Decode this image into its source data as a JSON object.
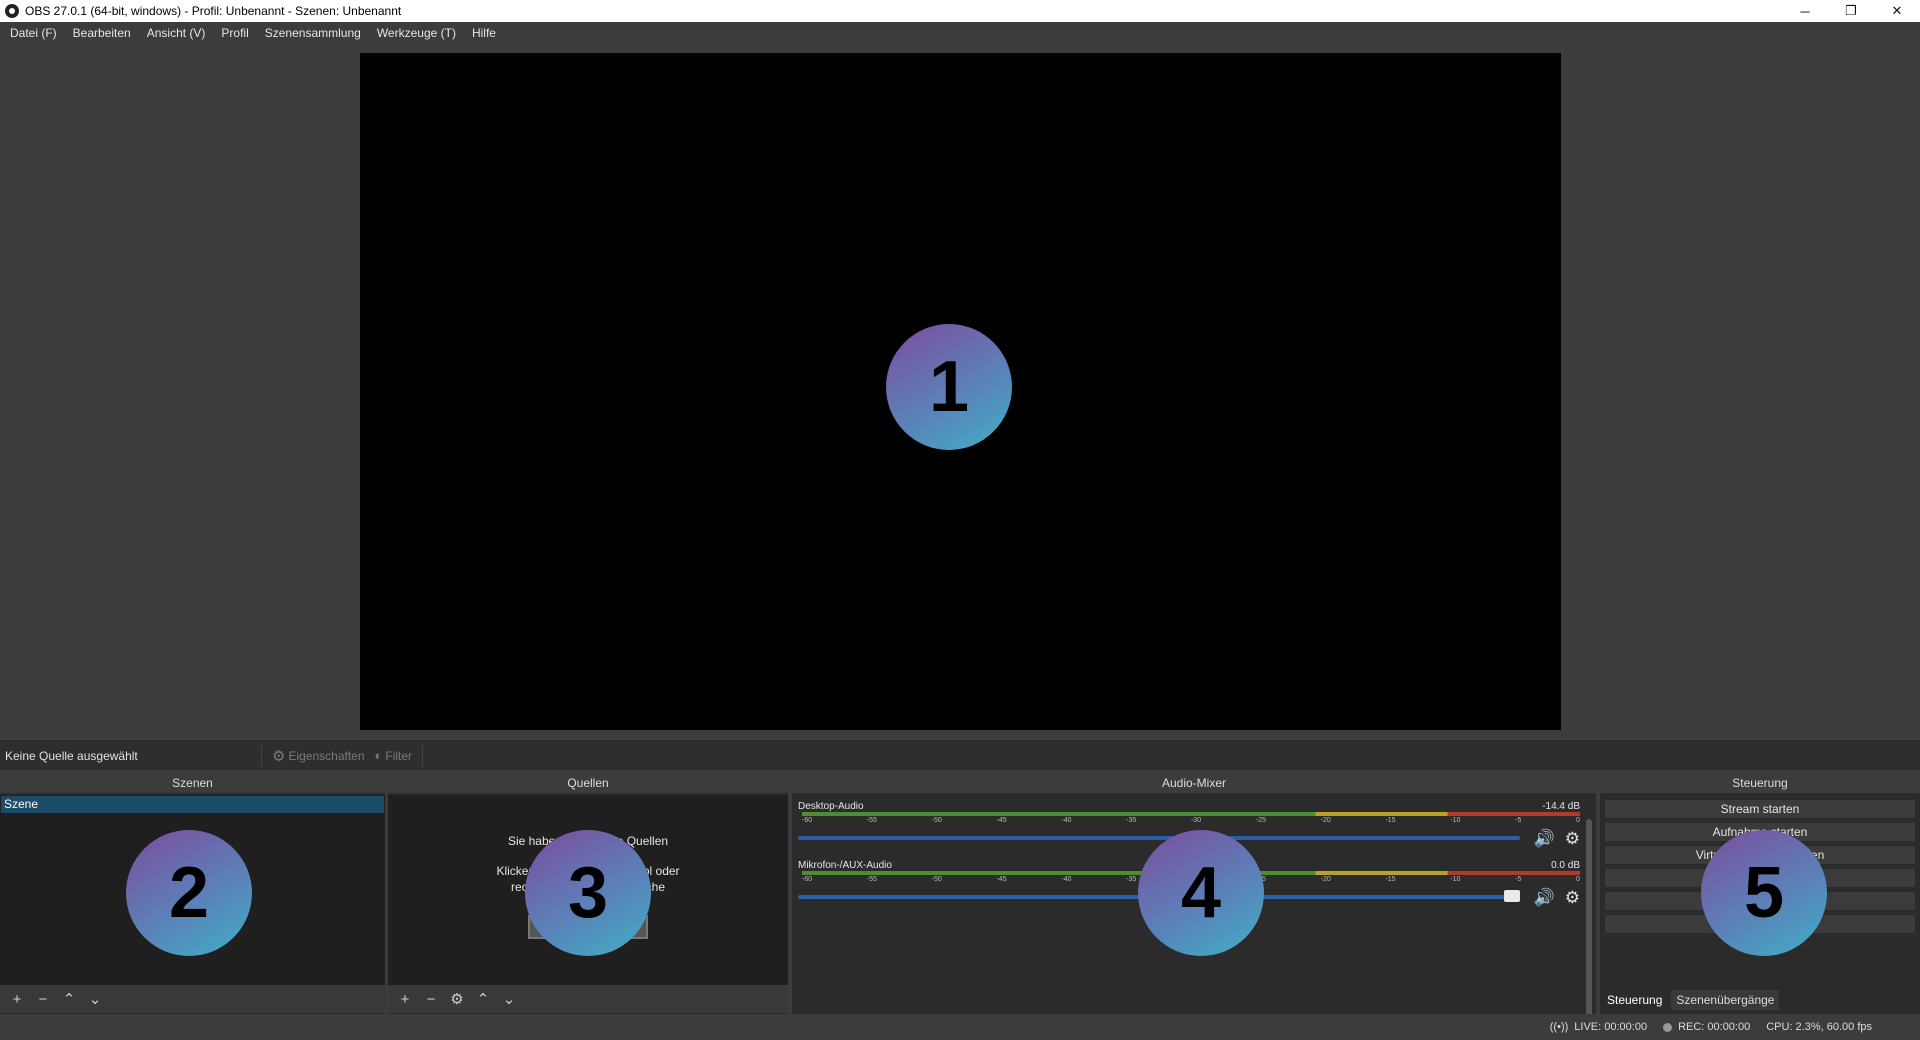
{
  "window": {
    "title": "OBS 27.0.1 (64-bit, windows) - Profil: Unbenannt - Szenen: Unbenannt",
    "minimize": "─",
    "restore": "❐",
    "close": "✕"
  },
  "menu": [
    "Datei (F)",
    "Bearbeiten",
    "Ansicht (V)",
    "Profil",
    "Szenensammlung",
    "Werkzeuge (T)",
    "Hilfe"
  ],
  "badges": [
    "1",
    "2",
    "3",
    "4",
    "5"
  ],
  "source_toolbar": {
    "no_source": "Keine Quelle ausgewählt",
    "properties": "Eigenschaften",
    "filter": "Filter"
  },
  "scenes": {
    "title": "Szenen",
    "items": [
      "Szene"
    ]
  },
  "sources": {
    "title": "Quellen",
    "empty_line1": "Sie haben noch keine Quellen",
    "empty_line2a": "Klicken Sie auf das + Symbol oder",
    "empty_line2b": "rechtsklicken Sie, um welche"
  },
  "mixer": {
    "title": "Audio-Mixer",
    "scale": [
      "-60",
      "-55",
      "-50",
      "-45",
      "-40",
      "-35",
      "-30",
      "-25",
      "-20",
      "-15",
      "-10",
      "-5",
      "0"
    ],
    "channels": [
      {
        "name": "Desktop-Audio",
        "db": "-14.4 dB",
        "volume": 0.5
      },
      {
        "name": "Mikrofon-/AUX-Audio",
        "db": "0.0 dB",
        "volume": 1.0
      }
    ]
  },
  "control": {
    "title": "Steuerung",
    "buttons": [
      "Stream starten",
      "Aufnahme starten",
      "Virtuelle Kamera starten",
      "",
      "",
      ""
    ],
    "tabs": [
      "Steuerung",
      "Szenenübergänge"
    ]
  },
  "status": {
    "live": "LIVE: 00:00:00",
    "rec": "REC: 00:00:00",
    "cpu": "CPU: 2.3%, 60.00 fps"
  },
  "icons": {
    "plus": "+",
    "minus": "−",
    "up": "⌃",
    "down": "⌄",
    "gear": "⚙",
    "speaker": "🔊"
  }
}
